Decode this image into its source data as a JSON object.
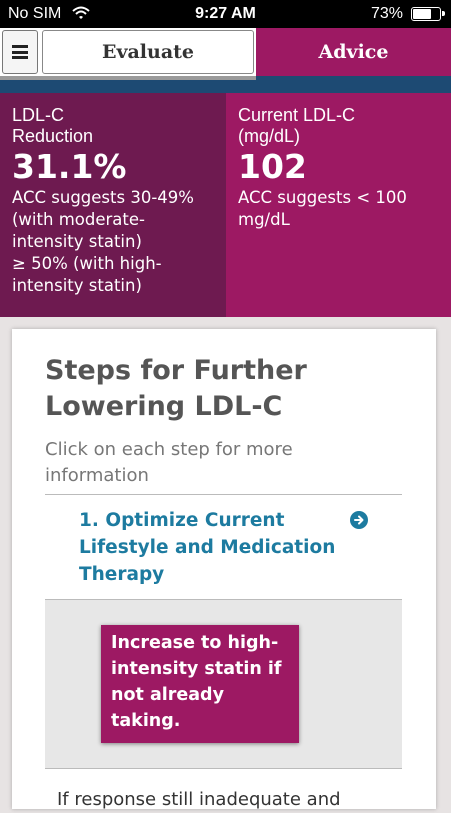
{
  "status_bar": {
    "carrier": "No SIM",
    "time": "9:27 AM",
    "battery_percent": "73%",
    "battery_level": 0.73
  },
  "tabs": {
    "evaluate_label": "Evaluate",
    "advice_label": "Advice",
    "active": "Advice"
  },
  "metrics": {
    "ldl_reduction": {
      "label_line1": "LDL-C",
      "label_line2": "Reduction",
      "value": "31.1%",
      "note_lines": [
        "ACC suggests 30-49%",
        "(with moderate-",
        "intensity statin)",
        "≥ 50% (with high-",
        "intensity statin)"
      ]
    },
    "current_ldl": {
      "label_line1": "Current LDL-C",
      "label_line2": "(mg/dL)",
      "value": "102",
      "note_lines": [
        "ACC suggests < 100",
        "mg/dL"
      ]
    }
  },
  "card": {
    "title": "Steps for Further Lowering LDL-C",
    "subtitle": "Click on each step for more information",
    "step1": {
      "label": "1. Optimize Current Lifestyle and Medication Therapy",
      "advice_lines": [
        "Increase to high-",
        "intensity statin if",
        "not already",
        "taking."
      ]
    },
    "next_text": "If response still inadequate and"
  },
  "colors": {
    "magenta": "#9d1963",
    "dark_magenta": "#6e1a50",
    "navy": "#1d4a73",
    "link_blue": "#1d7ba0"
  }
}
